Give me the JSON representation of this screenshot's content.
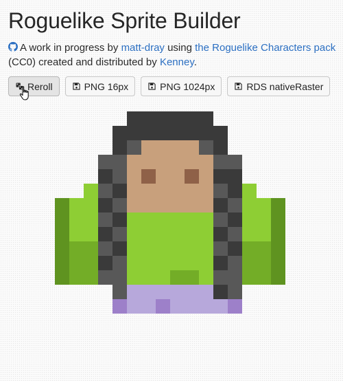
{
  "title": "Roguelike Sprite Builder",
  "intro": {
    "text_1": "A work in progress by ",
    "author_link": "matt-dray",
    "text_2": " using ",
    "pack_link": "the Roguelike Characters pack",
    "text_3": " (CC0) created and distributed by ",
    "kenney_link": "Kenney",
    "text_4": "."
  },
  "toolbar": {
    "reroll_label": "Reroll",
    "png16_label": "PNG 16px",
    "png1024_label": "PNG 1024px",
    "rds_label": "RDS nativeRaster"
  },
  "icons": {
    "github": "github-icon",
    "dice": "dice-icon",
    "save": "floppy-disk-icon",
    "cursor": "hand-pointer-cursor"
  },
  "sprite": {
    "grid_size": 16,
    "palette": {
      "H": "#3a3a3a",
      "h": "#585858",
      "S": "#c8a07c",
      "E": "#8f6148",
      "G": "#8ece34",
      "g": "#73ad27",
      "D": "#5f9320",
      "P": "#b7a8db",
      "p": "#9d80c9"
    },
    "rows": [
      "................",
      "................",
      ".....HHHHHH.....",
      "....HHHHHHHH....",
      "....HhSSSShH....",
      "...hhSSSSSShh...",
      "...HhSESSESHH...",
      "..GhHSSSSSShHG..",
      "DGGHhSSSSSSHhGGD",
      "DGGhHGGGGGGhHGGD",
      "DGGHhGGGGGGHhGGD",
      "DgghHGGGGGGhHggD",
      "DggHhGGGGGGHhggD",
      "DgghhGGGggGhhggD",
      "....hPPPPPPHh...",
      "....pPPpPPPPp..."
    ]
  },
  "colors": {
    "link": "#2b6fc2",
    "button_bg": "#f7f7f7",
    "button_border": "#c7c7c7",
    "page_bg": "#fbfbfb"
  }
}
